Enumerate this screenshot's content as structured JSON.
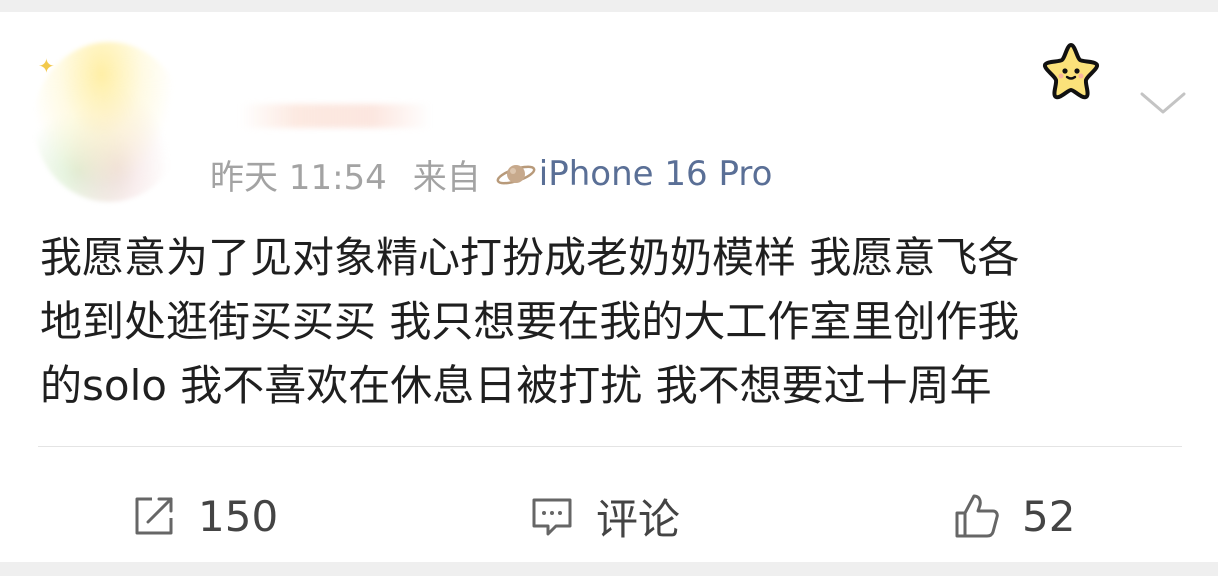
{
  "post": {
    "meta": {
      "time": "昨天 11:54",
      "source_prefix": "来自",
      "device": "iPhone 16 Pro"
    },
    "lines": [
      "我愿意为了见对象精心打扮成老奶奶模样 我愿意飞各",
      "地到处逛街买买买 我只想要在我的大工作室里创作我",
      "的solo 我不喜欢在休息日被打扰 我不想要过十周年"
    ]
  },
  "actions": {
    "repost_count": "150",
    "comment_label": "评论",
    "like_count": "52"
  },
  "icons": {
    "badge": "star-face-icon",
    "more": "chevron-down-icon",
    "source": "planet-icon",
    "repost": "repost-icon",
    "comment": "comment-icon",
    "like": "thumbs-up-icon"
  },
  "colors": {
    "device_link": "#5a6f96",
    "badge_yellow": "#fbe27a",
    "text": "#1f1f1f",
    "muted": "#a3a3a3"
  }
}
